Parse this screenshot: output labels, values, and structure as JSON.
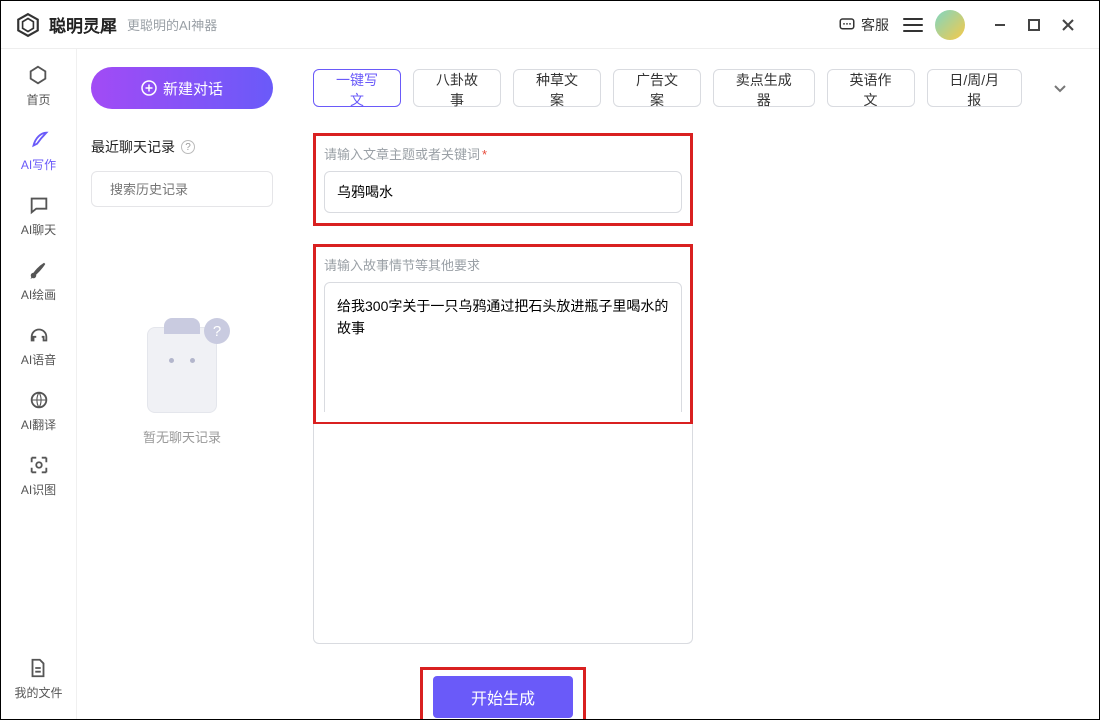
{
  "titlebar": {
    "appname": "聪明灵犀",
    "tagline": "更聪明的AI神器",
    "support": "客服"
  },
  "sidebar": {
    "items": [
      {
        "label": "首页",
        "icon": "home-hex"
      },
      {
        "label": "AI写作",
        "icon": "feather",
        "active": true
      },
      {
        "label": "AI聊天",
        "icon": "chat"
      },
      {
        "label": "AI绘画",
        "icon": "brush"
      },
      {
        "label": "AI语音",
        "icon": "headphones"
      },
      {
        "label": "AI翻译",
        "icon": "refresh-globe"
      },
      {
        "label": "AI识图",
        "icon": "image-eye"
      }
    ],
    "bottom": {
      "label": "我的文件",
      "icon": "file"
    }
  },
  "conv": {
    "new_chat": "新建对话",
    "recent_title": "最近聊天记录",
    "search_placeholder": "搜索历史记录",
    "empty_text": "暂无聊天记录"
  },
  "toolbar": {
    "tabs": [
      {
        "label": "一键写文",
        "active": true
      },
      {
        "label": "八卦故事"
      },
      {
        "label": "种草文案"
      },
      {
        "label": "广告文案"
      },
      {
        "label": "卖点生成器"
      },
      {
        "label": "英语作文"
      },
      {
        "label": "日/周/月报"
      }
    ]
  },
  "form": {
    "topic_label": "请输入文章主题或者关键词",
    "topic_value": "乌鸦喝水",
    "detail_label": "请输入故事情节等其他要求",
    "detail_value": "给我300字关于一只乌鸦通过把石头放进瓶子里喝水的故事",
    "generate": "开始生成"
  }
}
